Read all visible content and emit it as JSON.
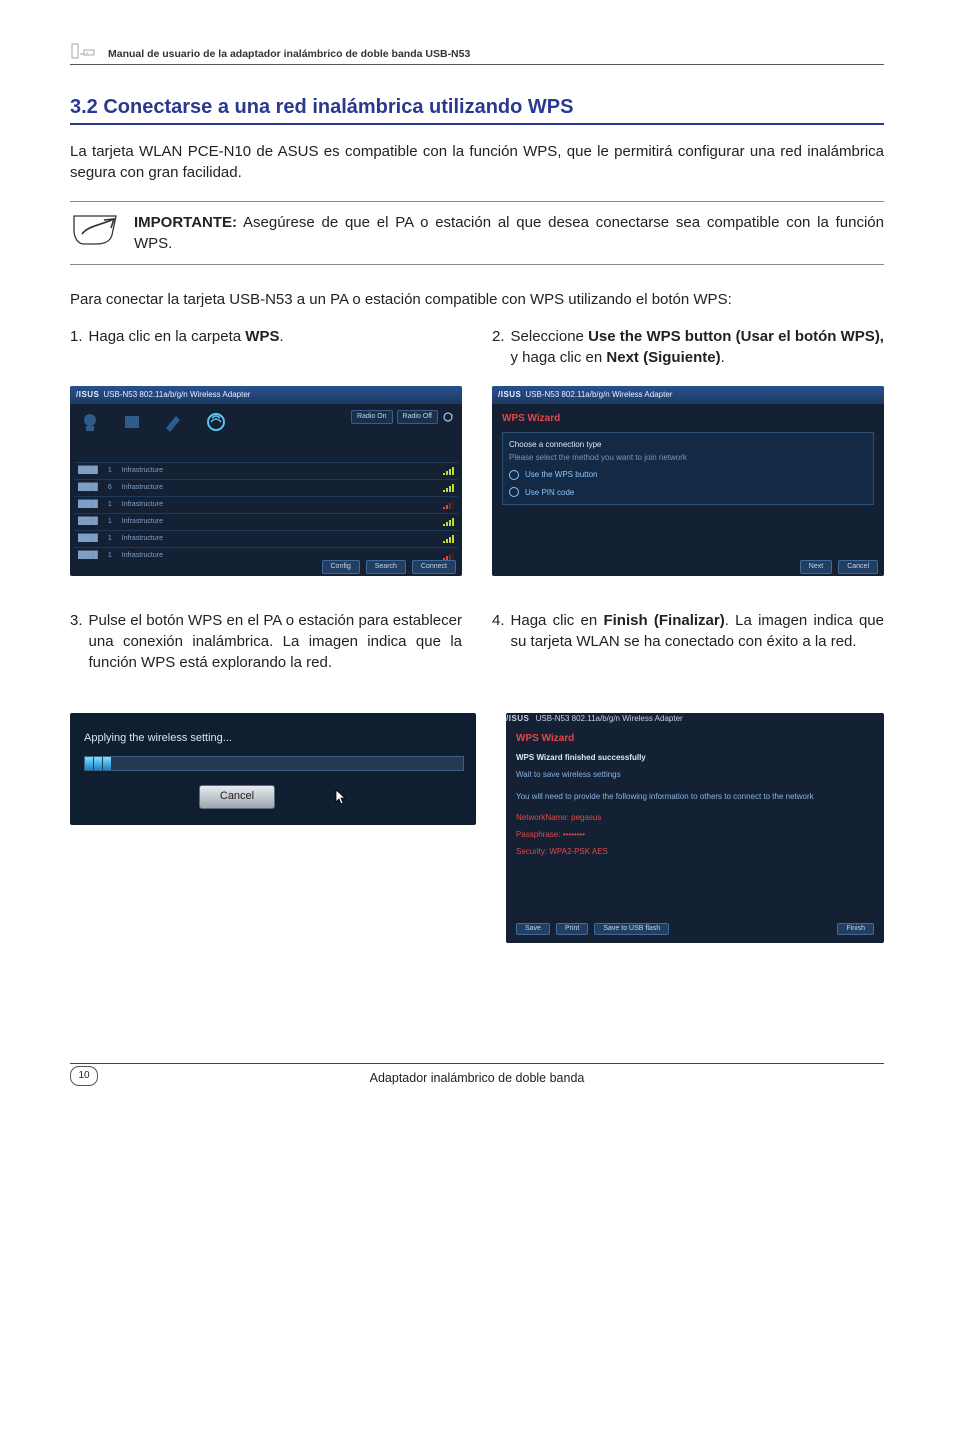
{
  "header": {
    "top_text": "Manual de usuario de la adaptador inalámbrico de doble banda USB-N53"
  },
  "section": {
    "title": "3.2    Conectarse a una red inalámbrica utilizando WPS",
    "intro": "La tarjeta WLAN PCE-N10 de ASUS es compatible con la función WPS, que le permitirá configurar una red inalámbrica segura con gran facilidad.",
    "callout_label": "IMPORTANTE:",
    "callout_body": "Asegúrese de que el PA o estación al que desea conectarse sea compatible con la función WPS.",
    "para2": "Para conectar la tarjeta USB-N53 a un PA o estación compatible con WPS utilizando el botón WPS:"
  },
  "steps": {
    "s1_num": "1.",
    "s1_a": "Haga clic en la carpeta ",
    "s1_b": "WPS",
    "s1_c": ".",
    "s2_num": "2.",
    "s2_a": "Seleccione ",
    "s2_b": "Use the WPS button (Usar el botón WPS),",
    "s2_c": " y haga clic en ",
    "s2_d": "Next (Siguiente)",
    "s2_e": ".",
    "s3_num": "3.",
    "s3_body": "Pulse el botón WPS en el PA o estación para establecer una conexión inalámbrica. La imagen indica que la función WPS está explorando la red.",
    "s4_num": "4.",
    "s4_a": "Haga clic en ",
    "s4_b": "Finish (Finalizar)",
    "s4_c": ". La imagen indica que su tarjeta WLAN se ha conectado con éxito a la red."
  },
  "shot1": {
    "brand": "/ISUS",
    "title_suffix": "USB-N53 802.11a/b/g/n Wireless Adapter",
    "radio_on": "Radio On",
    "radio_off": "Radio Off",
    "footer_config": "Config",
    "footer_search": "Search",
    "footer_connect": "Connect"
  },
  "shot2": {
    "brand": "/ISUS",
    "title_suffix": "USB-N53 802.11a/b/g/n Wireless Adapter",
    "wiz_title": "WPS Wizard",
    "sub_heading": "Choose a connection type",
    "sub_desc": "Please select the method you want to join network",
    "opt1": "Use the WPS button",
    "opt2": "Use PIN code",
    "btn_next": "Next",
    "btn_cancel": "Cancel"
  },
  "shot3": {
    "apply_label": "Applying the wireless setting...",
    "cancel": "Cancel"
  },
  "shot4": {
    "brand": "/ISUS",
    "title_suffix": "USB-N53 802.11a/b/g/n Wireless Adapter",
    "wiz_title": "WPS Wizard",
    "line1": "WPS Wizard finished successfully",
    "line2": "Wait to save wireless settings",
    "line3": "You will need to provide the following information to others to connect to the network",
    "field_network": "NetworkName:  pegasus",
    "field_pass": "Passphrase:  ••••••••",
    "field_security": "Security:  WPA2-PSK AES",
    "btn_save": "Save",
    "btn_print": "Print",
    "btn_save_usb": "Save to USB flash",
    "btn_finish": "Finish"
  },
  "footer": {
    "page_num": "10",
    "text": "Adaptador inalámbrico de doble banda"
  }
}
